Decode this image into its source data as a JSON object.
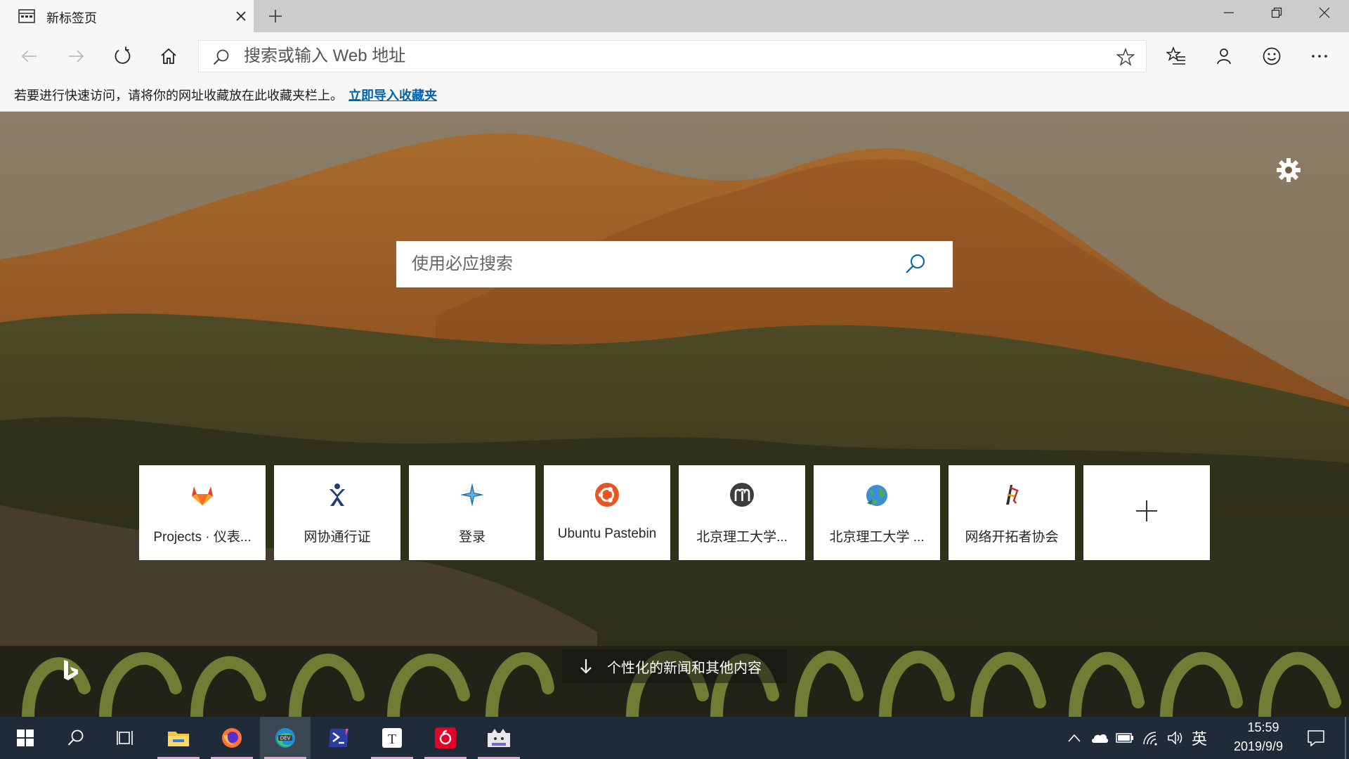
{
  "tab": {
    "title": "新标签页",
    "icon": "newtab-page-icon"
  },
  "window_controls": [
    "minimize-icon",
    "restore-icon",
    "close-icon"
  ],
  "toolbar": {
    "address_placeholder": "搜索或输入 Web 地址",
    "icons": [
      "back-arrow-icon",
      "forward-arrow-icon",
      "refresh-icon",
      "home-icon",
      "search-icon",
      "favorite-star-icon",
      "favorites-list-icon",
      "profile-icon",
      "feedback-smiley-icon",
      "more-icon"
    ]
  },
  "favorites_bar": {
    "message": "若要进行快速访问，请将你的网址收藏放在此收藏夹栏上。",
    "link": "立即导入收藏夹"
  },
  "ntp": {
    "search_placeholder": "使用必应搜索",
    "settings_icon": "gear-icon",
    "top_sites": [
      {
        "label": "Projects · 仪表...",
        "icon": "gitlab-icon"
      },
      {
        "label": "网协通行证",
        "icon": "netassoc-passport-icon"
      },
      {
        "label": "登录",
        "icon": "compass-star-icon"
      },
      {
        "label": "Ubuntu Pastebin",
        "icon": "ubuntu-icon"
      },
      {
        "label": "北京理工大学...",
        "icon": "moodle-icon"
      },
      {
        "label": "北京理工大学 ...",
        "icon": "globe-icon"
      },
      {
        "label": "网络开拓者协会",
        "icon": "pioneer-icon"
      }
    ],
    "add_site_icon": "plus-icon",
    "news_button": "个性化的新闻和其他内容",
    "bing_logo": "bing-logo-icon"
  },
  "taskbar": {
    "apps": [
      "windows-start-icon",
      "search-icon",
      "task-view-icon",
      "file-explorer-icon",
      "firefox-icon",
      "edge-dev-icon",
      "terminal-icon",
      "typora-icon",
      "netease-music-icon",
      "cat-app-icon"
    ],
    "tray_icons": [
      "chevron-up-icon",
      "onedrive-icon",
      "battery-icon",
      "wifi-icon",
      "volume-icon"
    ],
    "ime": "英",
    "time": "15:59",
    "date": "2019/9/9",
    "notification_icon": "action-center-icon"
  },
  "colors": {
    "accent_link": "#0063b1",
    "taskbar": "#1f2b38",
    "chrome": "#f7f7f7"
  }
}
